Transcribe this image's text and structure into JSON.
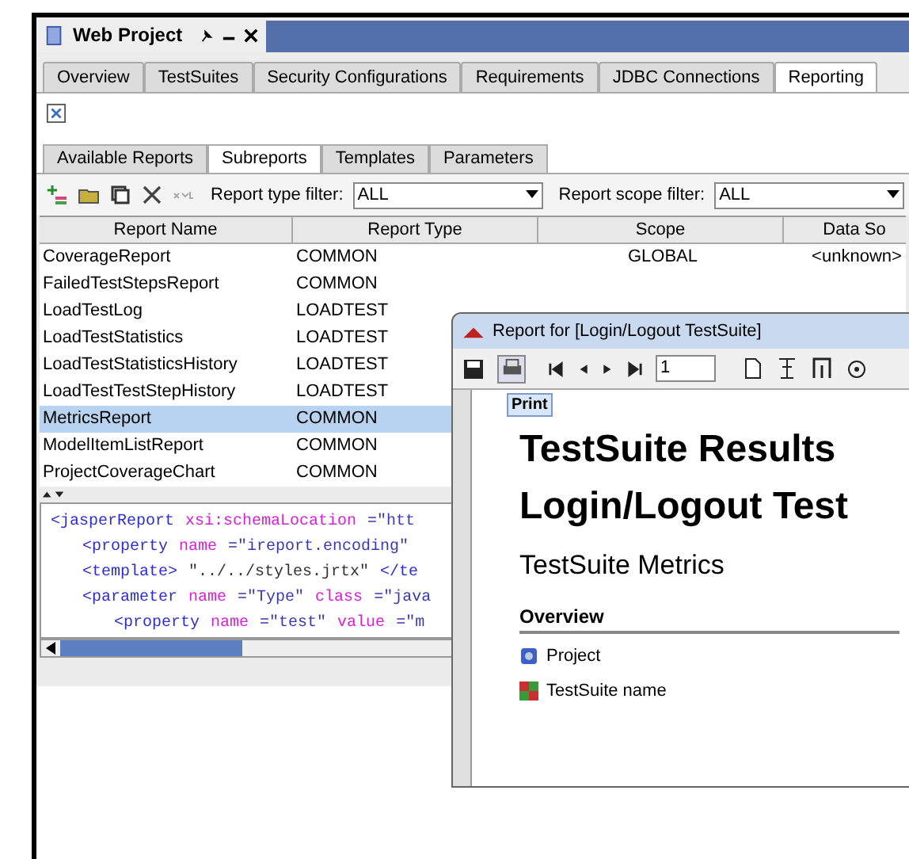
{
  "window": {
    "title": "Web Project"
  },
  "tabs": [
    {
      "label": "Overview",
      "selected": false
    },
    {
      "label": "TestSuites",
      "selected": false
    },
    {
      "label": "Security Configurations",
      "selected": false
    },
    {
      "label": "Requirements",
      "selected": false
    },
    {
      "label": "JDBC Connections",
      "selected": false
    },
    {
      "label": "Reporting",
      "selected": true
    }
  ],
  "subtabs": [
    {
      "label": "Available Reports",
      "selected": false
    },
    {
      "label": "Subreports",
      "selected": true
    },
    {
      "label": "Templates",
      "selected": false
    },
    {
      "label": "Parameters",
      "selected": false
    }
  ],
  "toolbar": {
    "filters": [
      {
        "label": "Report type filter:",
        "value": "ALL"
      },
      {
        "label": "Report scope filter:",
        "value": "ALL"
      }
    ]
  },
  "table": {
    "columns": [
      "Report Name",
      "Report Type",
      "Scope",
      "Data So"
    ],
    "rows": [
      {
        "cells": [
          "CoverageReport",
          "COMMON",
          "GLOBAL",
          "<unknown>"
        ],
        "selected": false
      },
      {
        "cells": [
          "FailedTestStepsReport",
          "COMMON"
        ],
        "selected": false
      },
      {
        "cells": [
          "LoadTestLog",
          "LOADTEST"
        ],
        "selected": false
      },
      {
        "cells": [
          "LoadTestStatistics",
          "LOADTEST"
        ],
        "selected": false
      },
      {
        "cells": [
          "LoadTestStatisticsHistory",
          "LOADTEST"
        ],
        "selected": false
      },
      {
        "cells": [
          "LoadTestTestStepHistory",
          "LOADTEST"
        ],
        "selected": false
      },
      {
        "cells": [
          "MetricsReport",
          "COMMON"
        ],
        "selected": true
      },
      {
        "cells": [
          "ModelItemListReport",
          "COMMON"
        ],
        "selected": false
      },
      {
        "cells": [
          "ProjectCoverageChart",
          "COMMON"
        ],
        "selected": false
      }
    ]
  },
  "editor": {
    "lines": [
      {
        "tokens": [
          {
            "kind": "tag",
            "text": "<jasperReport"
          },
          {
            "kind": "attr",
            "text": "xsi:schemaLocation"
          },
          {
            "kind": "value",
            "text": "=\"htt"
          }
        ],
        "children": [
          {
            "tokens": [
              {
                "kind": "tag",
                "text": "<property"
              },
              {
                "kind": "attr",
                "text": "name"
              },
              {
                "kind": "value",
                "text": "=\"ireport.encoding\""
              }
            ]
          },
          {
            "tokens": [
              {
                "kind": "tag",
                "text": "<template>"
              },
              {
                "kind": "text",
                "text": "\"../../styles.jrtx\""
              },
              {
                "kind": "tag",
                "text": "</te"
              }
            ]
          },
          {
            "tokens": [
              {
                "kind": "tag",
                "text": "<parameter"
              },
              {
                "kind": "attr",
                "text": "name"
              },
              {
                "kind": "value",
                "text": "=\"Type\""
              },
              {
                "kind": "attr",
                "text": "class"
              },
              {
                "kind": "value",
                "text": "=\"java"
              }
            ],
            "children": [
              {
                "tokens": [
                  {
                    "kind": "tag",
                    "text": "<property"
                  },
                  {
                    "kind": "attr",
                    "text": "name"
                  },
                  {
                    "kind": "value",
                    "text": "=\"test\""
                  },
                  {
                    "kind": "attr",
                    "text": "value"
                  },
                  {
                    "kind": "value",
                    "text": "=\"m"
                  }
                ]
              }
            ]
          }
        ]
      }
    ]
  },
  "dialog": {
    "title": "Report for [Login/Logout TestSuite]",
    "page": "1",
    "tooltip": "Print",
    "headings": [
      "TestSuite Results",
      "Login/Logout Test"
    ],
    "subheading": "TestSuite Metrics",
    "section": "Overview",
    "items": [
      {
        "kind": "project",
        "label": "Project"
      },
      {
        "kind": "testsuite",
        "label": "TestSuite name"
      }
    ]
  }
}
